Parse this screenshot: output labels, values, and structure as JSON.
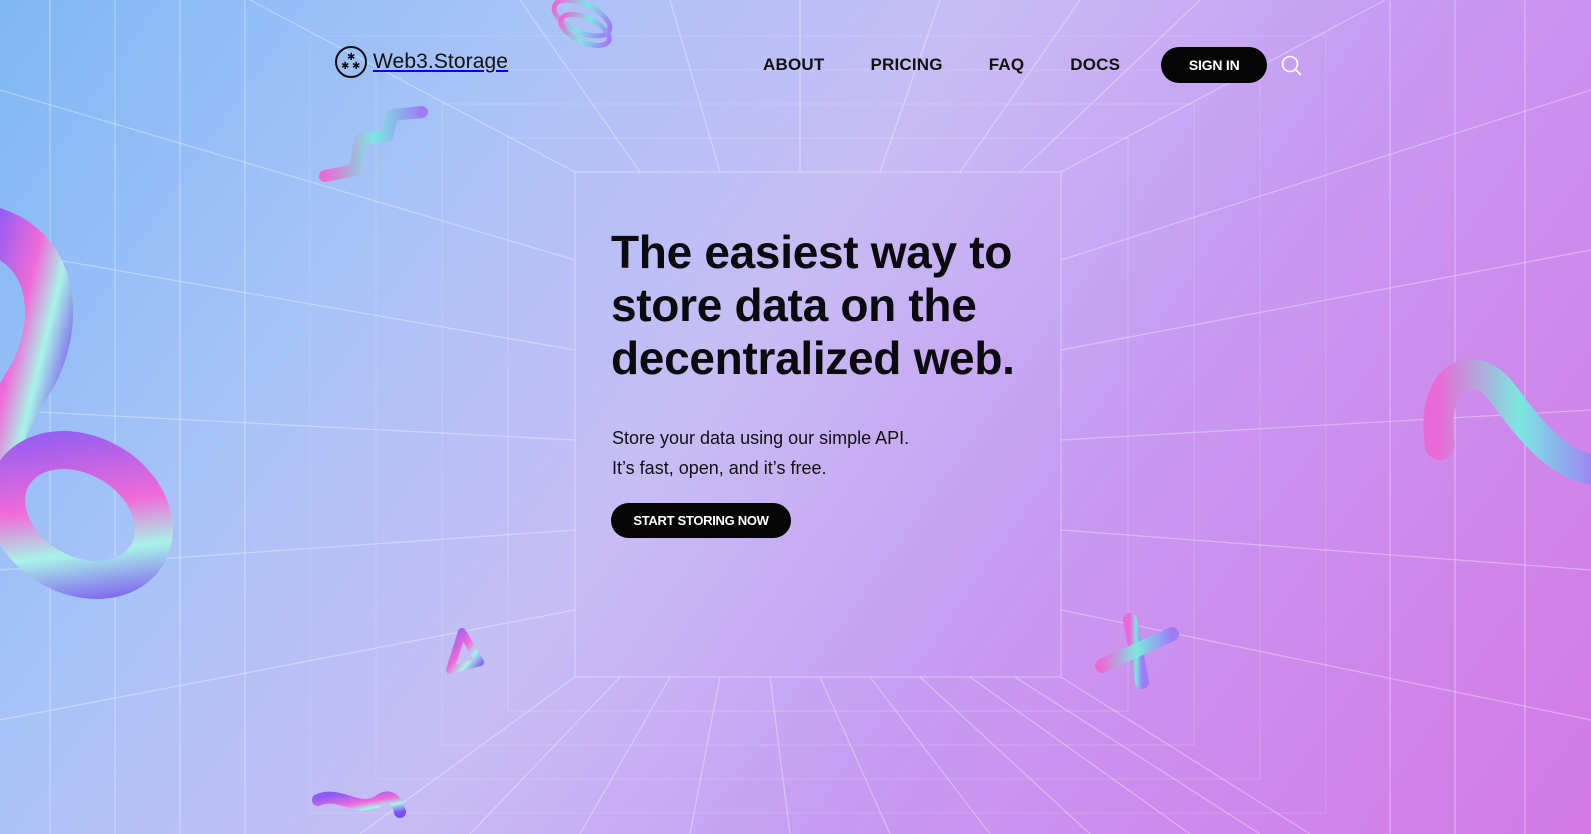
{
  "brand": {
    "name": "Web3.Storage",
    "icon": "asterisk-cluster-logo-icon"
  },
  "nav": {
    "items": [
      {
        "label": "ABOUT"
      },
      {
        "label": "PRICING"
      },
      {
        "label": "FAQ"
      },
      {
        "label": "DOCS"
      }
    ],
    "signin_label": "SIGN IN",
    "search_icon": "search-icon"
  },
  "hero": {
    "title": "The easiest way to store data on the decentralized web.",
    "subtitle_line1": "Store your data using our simple API.",
    "subtitle_line2": "It’s fast, open, and it’s free.",
    "cta_label": "START STORING NOW"
  },
  "colors": {
    "button_bg": "#050505",
    "button_text": "#ffffff",
    "text": "#0a0a0f",
    "gradient_start": "#7fb8f4",
    "gradient_end": "#d27ae6"
  }
}
